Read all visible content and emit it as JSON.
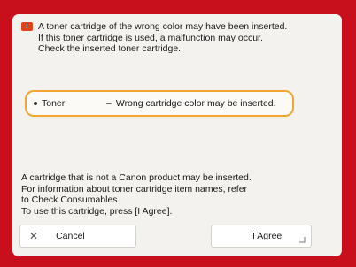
{
  "header": {
    "icon": "warning-icon",
    "lines": [
      "A toner cartridge of the wrong color may have been inserted.",
      "If this toner cartridge is used, a malfunction may occur.",
      "Check the inserted toner cartridge."
    ]
  },
  "alert": {
    "item": "Toner",
    "message": "Wrong cartridge color may be inserted.",
    "highlight_color": "#f0a630"
  },
  "notice": {
    "lines": [
      "A cartridge that is not a Canon product may be inserted.",
      "For information about toner cartridge item names, refer",
      "to Check Consumables.",
      "To use this cartridge, press [I Agree]."
    ]
  },
  "buttons": {
    "cancel": {
      "icon": "close-icon",
      "label": "Cancel"
    },
    "agree": {
      "label": "I Agree",
      "icon": "enter-corner-icon"
    }
  },
  "colors": {
    "frame": "#c8101c",
    "panel": "#f4f2ee",
    "warning_icon": "#e2401a"
  }
}
